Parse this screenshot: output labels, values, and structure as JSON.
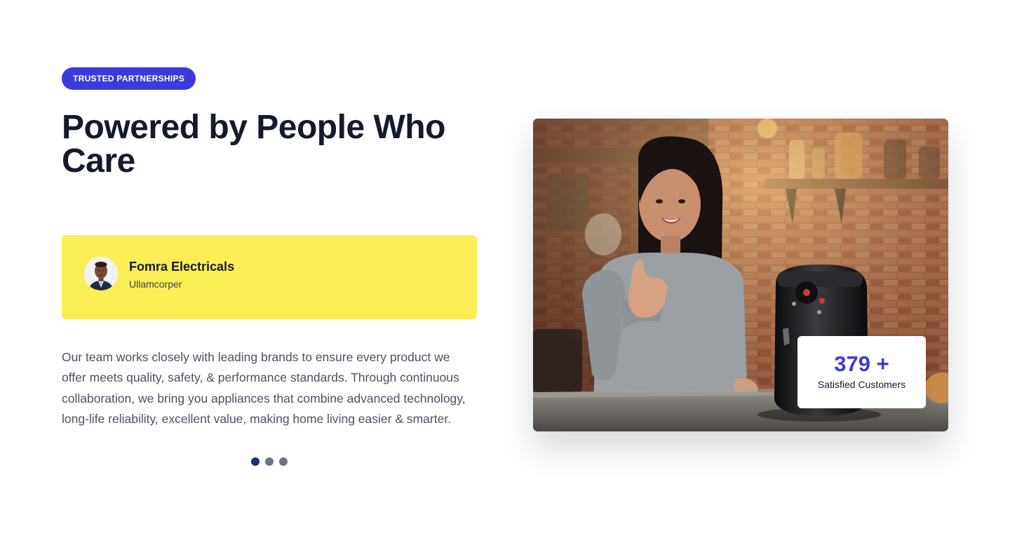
{
  "badge": {
    "label": "TRUSTED PARTNERSHIPS"
  },
  "hero": {
    "title": "Powered by People Who Care"
  },
  "testimonial": {
    "name": "Fomra Electricals",
    "role": "Ullamcorper"
  },
  "description": "Our team works closely with leading brands to ensure every product we offer meets quality, safety, & performance standards. Through continuous collaboration, we bring you appliances that combine advanced technology, long-life reliability, excellent value, making home living easier & smarter.",
  "carousel": {
    "slides": 3,
    "active_index": 0
  },
  "stat": {
    "number": "379 +",
    "label": "Satisfied Customers"
  },
  "colors": {
    "accent": "#3b3bdb",
    "card_yellow": "#fbee55",
    "heading": "#141a2c",
    "dot_active": "#1e2f80",
    "dot_inactive": "#6f7288"
  }
}
